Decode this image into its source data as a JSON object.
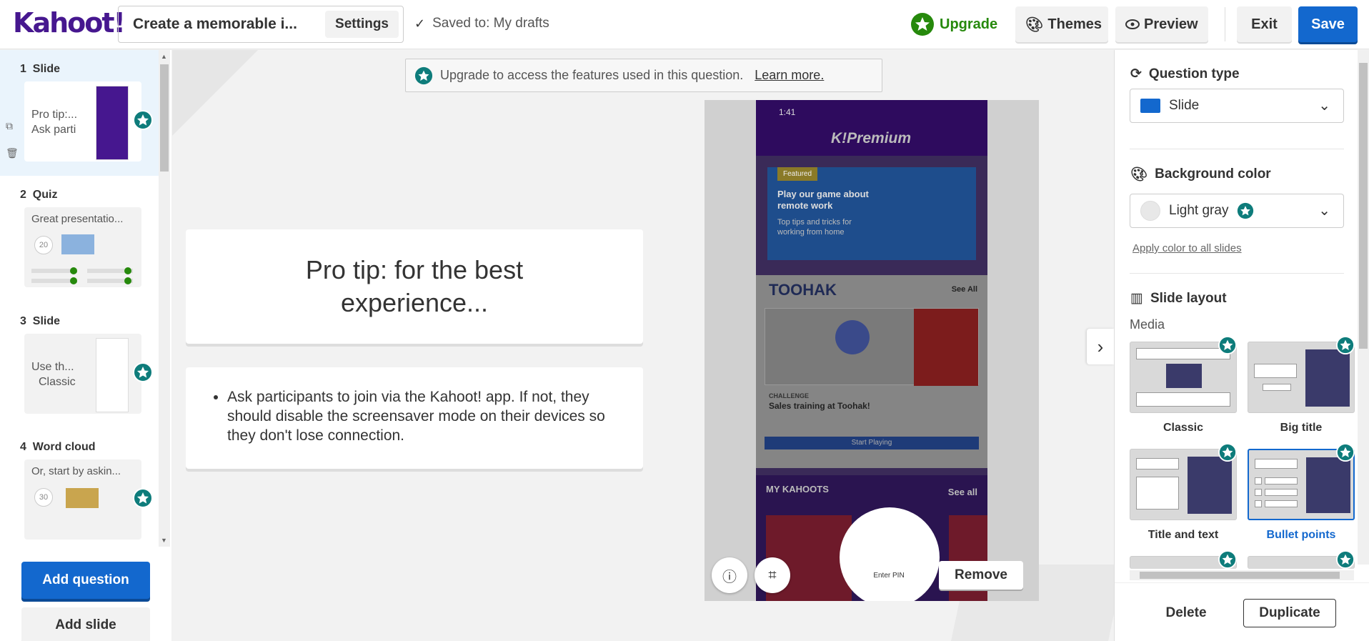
{
  "app": {
    "logo": "Kahoot!",
    "colors": {
      "brand": "#46178f",
      "accent": "#1368ce",
      "premium": "#26890c"
    }
  },
  "topbar": {
    "title": "Create a memorable i...",
    "settings": "Settings",
    "saved": "Saved to: My drafts",
    "upgrade": "Upgrade",
    "themes": "Themes",
    "preview": "Preview",
    "exit": "Exit",
    "save": "Save"
  },
  "slides": [
    {
      "num": "1",
      "type": "Slide",
      "line1": "Pro tip:...",
      "line2": "Ask parti"
    },
    {
      "num": "2",
      "type": "Quiz",
      "text": "Great presentatio...",
      "timer": "20"
    },
    {
      "num": "3",
      "type": "Slide",
      "line1": "Use th...",
      "line2": "Classic"
    },
    {
      "num": "4",
      "type": "Word cloud",
      "text": "Or, start by askin...",
      "timer": "30"
    }
  ],
  "left_buttons": {
    "add_question": "Add question",
    "add_slide": "Add slide"
  },
  "banner": {
    "text": "Upgrade to access the features used in this question.",
    "link": "Learn more."
  },
  "editor": {
    "title": "Pro tip: for the best experience...",
    "bullet": "Ask participants to join via the Kahoot! app. If not, they should disable the screensaver mode on their devices so they don't lose connection."
  },
  "media": {
    "time": "1:41",
    "brand": "K!Premium",
    "featured": "Featured",
    "feat_title": "Play our game about remote work",
    "feat_sub": "Top tips and tricks for working from home",
    "company": "TOOHAK",
    "see_all": "See All",
    "challenge": "CHALLENGE",
    "challenge_title": "Sales training at Toohak!",
    "start": "Start Playing",
    "my_kahoots": "MY KAHOOTS",
    "see_all2": "See all",
    "enter_pin": "Enter PIN",
    "remove": "Remove"
  },
  "right": {
    "qtype_label": "Question type",
    "qtype_value": "Slide",
    "bg_label": "Background color",
    "bg_value": "Light gray",
    "apply": "Apply color to all slides",
    "layout_label": "Slide layout",
    "media_label": "Media",
    "layouts": [
      "Classic",
      "Big title",
      "Title and text",
      "Bullet points"
    ],
    "delete": "Delete",
    "duplicate": "Duplicate"
  }
}
